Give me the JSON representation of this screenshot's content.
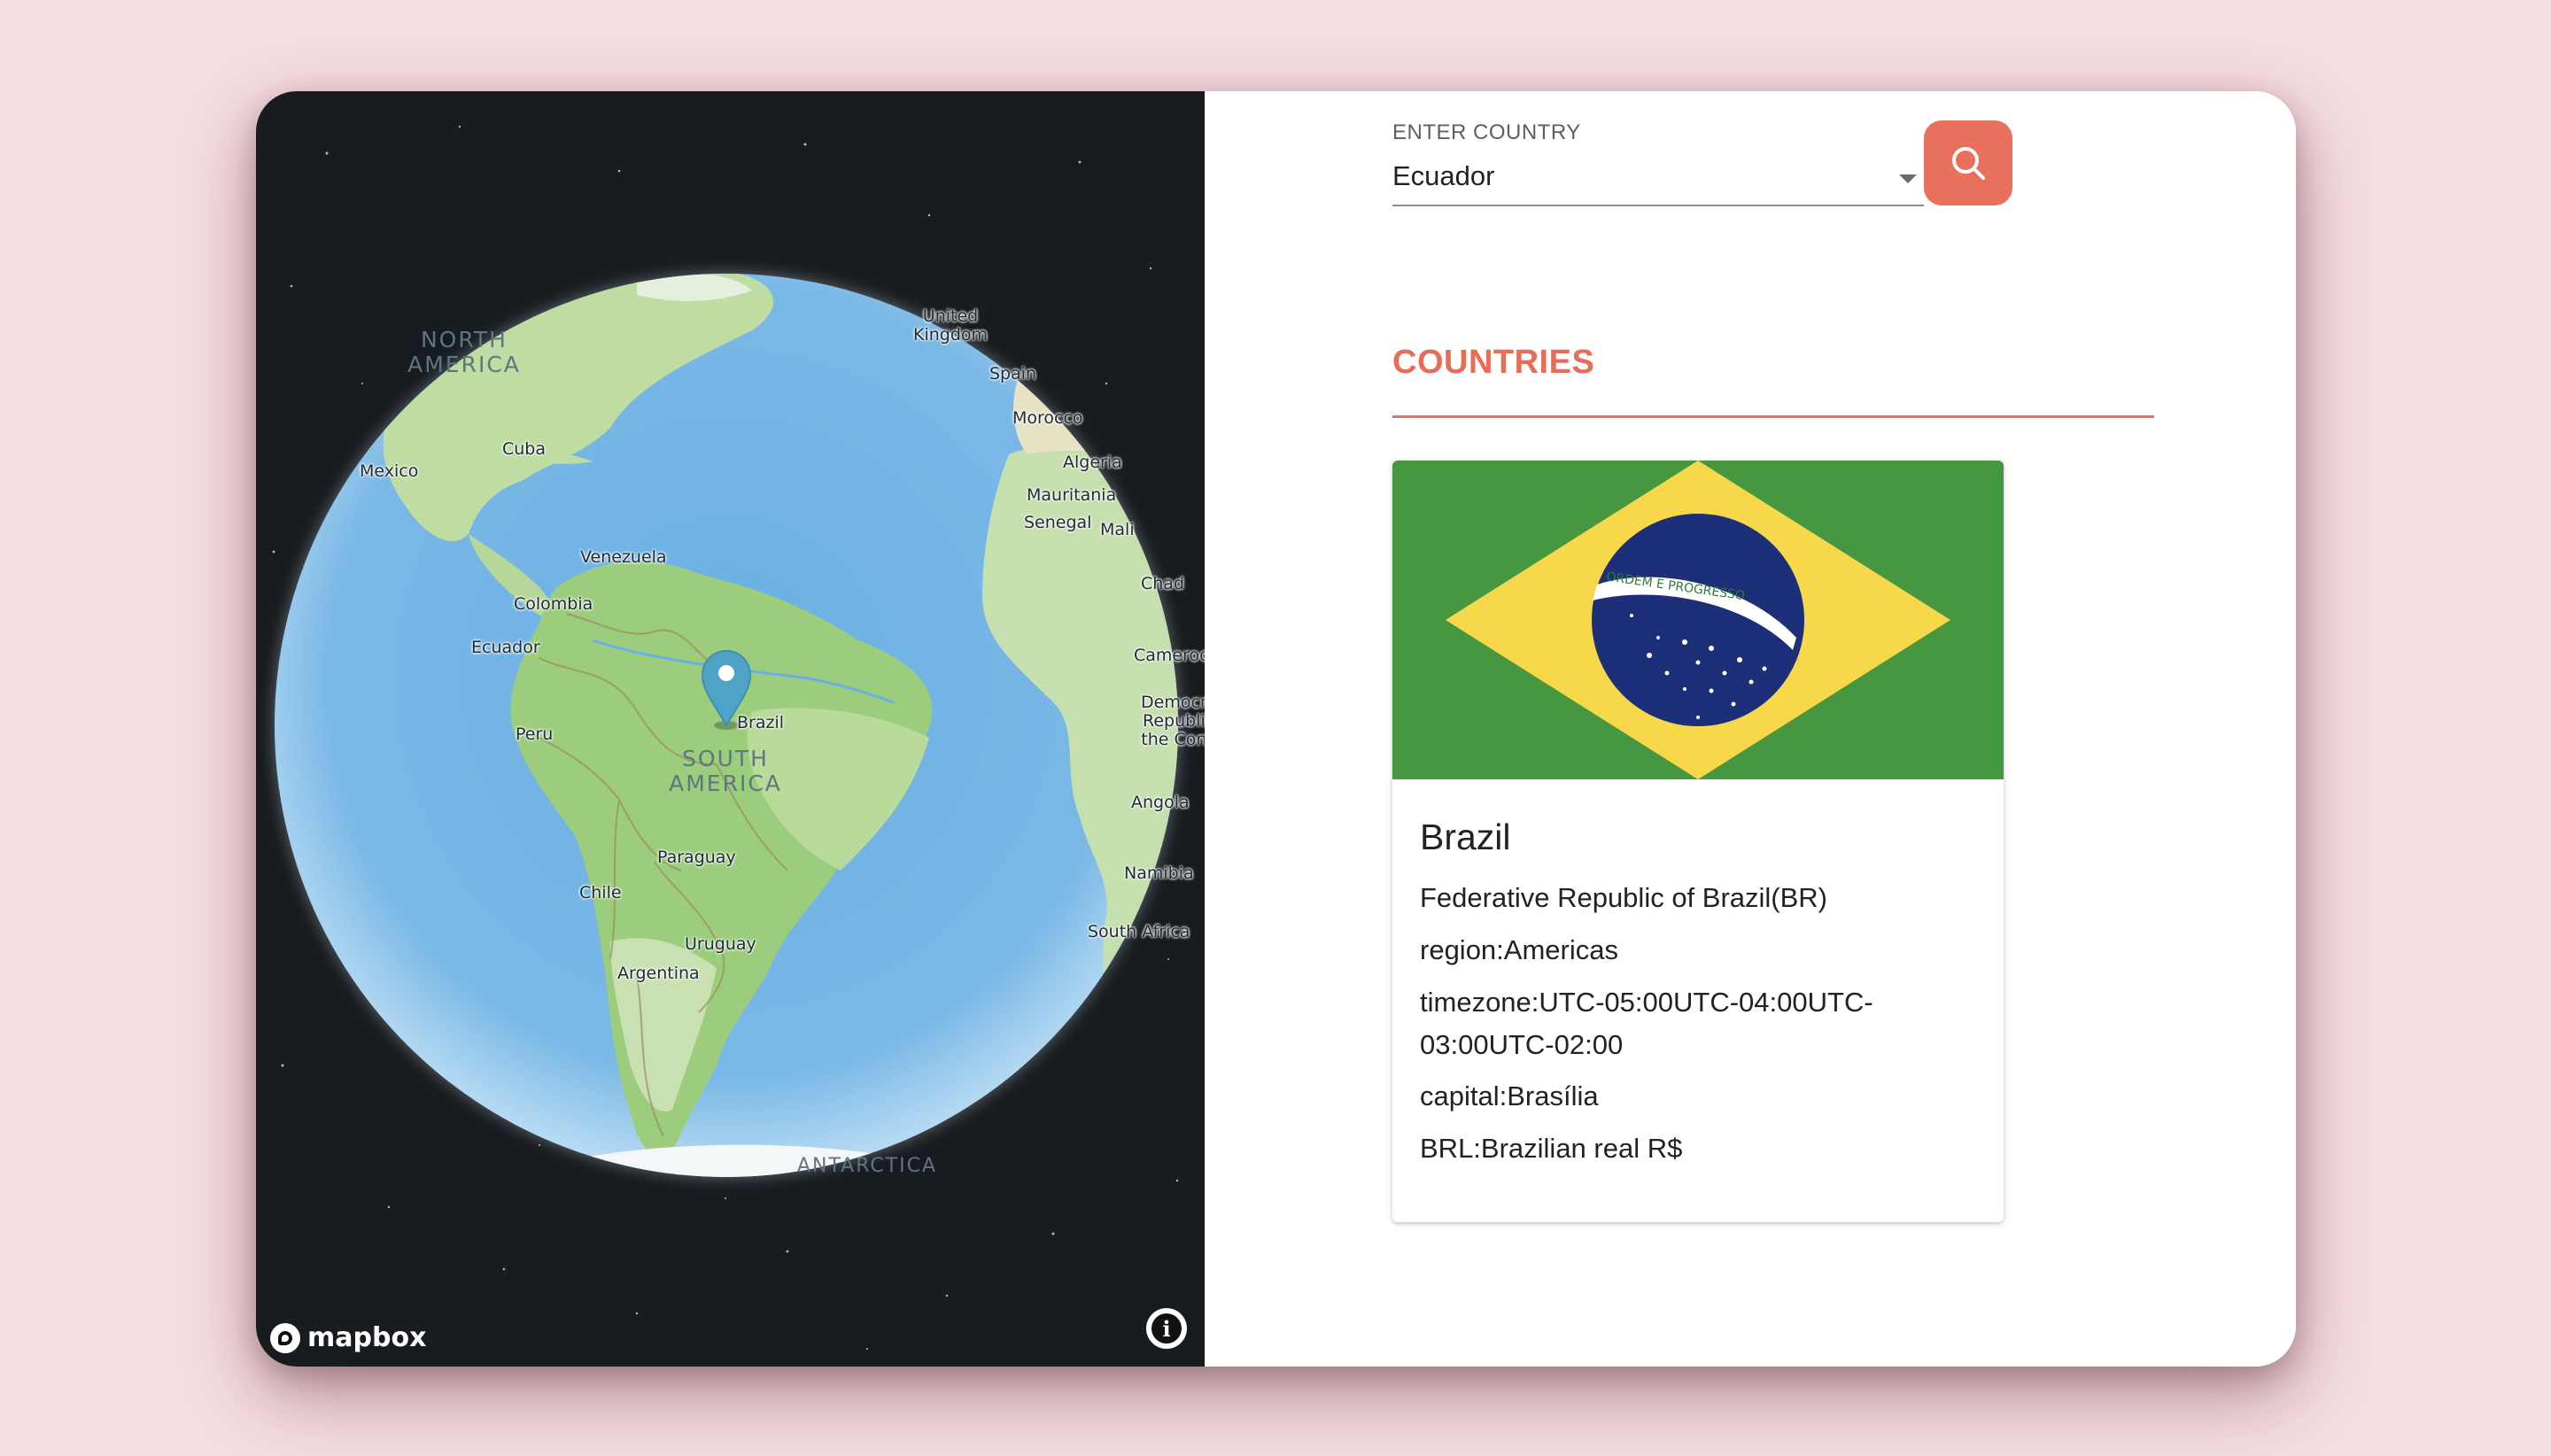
{
  "map": {
    "labels": {
      "united_kingdom": "United\nKingdom",
      "spain": "Spain",
      "morocco": "Morocco",
      "algeria": "Algeria",
      "mauritania": "Mauritania",
      "senegal": "Senegal",
      "mali": "Mali",
      "chad": "Chad",
      "cameroon": "Cameroo",
      "drc": "Democr\nRepubli\nthe Con",
      "angola": "Angola",
      "namibia": "Namibia",
      "south_africa": "South Africa",
      "cuba": "Cuba",
      "mexico": "Mexico",
      "venezuela": "Venezuela",
      "colombia": "Colombia",
      "ecuador": "Ecuador",
      "peru": "Peru",
      "brazil": "Brazil",
      "paraguay": "Paraguay",
      "chile": "Chile",
      "uruguay": "Uruguay",
      "argentina": "Argentina"
    },
    "continents": {
      "north_america": "NORTH\nAMERICA",
      "south_america": "SOUTH\nAMERICA",
      "antarctica": "ANTARCTICA"
    },
    "attribution_logo": "mapbox",
    "info_icon": "i"
  },
  "search": {
    "label": "ENTER COUNTRY",
    "value": "Ecuador",
    "search_icon": "search-icon"
  },
  "section_title": "COUNTRIES",
  "country": {
    "name": "Brazil",
    "official": "Federative Republic of Brazil(BR)",
    "region": "region:Americas",
    "timezone": "timezone:UTC-05:00UTC-04:00UTC-03:00UTC-02:00",
    "capital": "capital:Brasília",
    "currency": "BRL:Brazilian real R$",
    "flag_motto": "ORDEM E PROGRESSO"
  },
  "colors": {
    "accent": "#e8715e",
    "background": "#f5dde1",
    "flag_green": "#46973f",
    "flag_yellow": "#f7d84b",
    "flag_blue": "#1c2f78"
  }
}
